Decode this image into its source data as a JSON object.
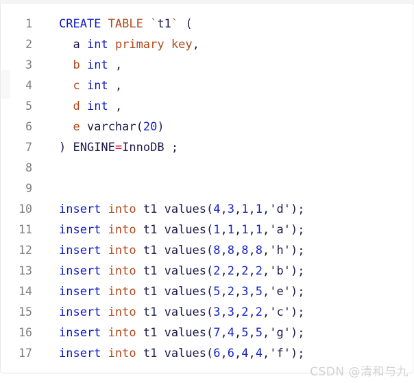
{
  "watermark": {
    "text": "CSDN @清和与九"
  },
  "colors": {
    "keyword_blue": "#0d19c8",
    "keyword_rust": "#b2481c",
    "identifier": "#1b1b4b",
    "number": "#1622c6",
    "equals": "#d81243",
    "line_number": "#7f7f7f",
    "background": "#ffffff",
    "border": "#e8e8e8",
    "watermark": "#d2d2d2"
  },
  "code_block": {
    "language": "sql",
    "lines": [
      {
        "number": "1",
        "text": "CREATE TABLE `t1` (",
        "tokens": [
          {
            "t": "CREATE",
            "c": "kw"
          },
          {
            "t": " ",
            "c": "op"
          },
          {
            "t": "TABLE",
            "c": "kw2"
          },
          {
            "t": " ",
            "c": "op"
          },
          {
            "t": "`",
            "c": "tick"
          },
          {
            "t": "t1",
            "c": "id"
          },
          {
            "t": "`",
            "c": "tick"
          },
          {
            "t": " (",
            "c": "op"
          }
        ]
      },
      {
        "number": "2",
        "text": "  a int primary key,",
        "tokens": [
          {
            "t": "  ",
            "c": "op"
          },
          {
            "t": "a",
            "c": "id"
          },
          {
            "t": " ",
            "c": "op"
          },
          {
            "t": "int",
            "c": "kw"
          },
          {
            "t": " ",
            "c": "op"
          },
          {
            "t": "primary",
            "c": "kw2"
          },
          {
            "t": " ",
            "c": "op"
          },
          {
            "t": "key",
            "c": "kw2"
          },
          {
            "t": ",",
            "c": "op"
          }
        ]
      },
      {
        "number": "3",
        "text": "  b int ,",
        "tokens": [
          {
            "t": "  ",
            "c": "op"
          },
          {
            "t": "b",
            "c": "col"
          },
          {
            "t": " ",
            "c": "op"
          },
          {
            "t": "int",
            "c": "kw"
          },
          {
            "t": " ",
            "c": "op"
          },
          {
            "t": ",",
            "c": "op"
          }
        ]
      },
      {
        "number": "4",
        "text": "  c int ,",
        "tokens": [
          {
            "t": "  ",
            "c": "op"
          },
          {
            "t": "c",
            "c": "col"
          },
          {
            "t": " ",
            "c": "op"
          },
          {
            "t": "int",
            "c": "kw"
          },
          {
            "t": " ",
            "c": "op"
          },
          {
            "t": ",",
            "c": "op"
          }
        ]
      },
      {
        "number": "5",
        "text": "  d int ,",
        "tokens": [
          {
            "t": "  ",
            "c": "op"
          },
          {
            "t": "d",
            "c": "col"
          },
          {
            "t": " ",
            "c": "op"
          },
          {
            "t": "int",
            "c": "kw"
          },
          {
            "t": " ",
            "c": "op"
          },
          {
            "t": ",",
            "c": "op"
          }
        ]
      },
      {
        "number": "6",
        "text": "  e varchar(20)",
        "tokens": [
          {
            "t": "  ",
            "c": "op"
          },
          {
            "t": "e",
            "c": "col"
          },
          {
            "t": " ",
            "c": "op"
          },
          {
            "t": "varchar",
            "c": "id"
          },
          {
            "t": "(",
            "c": "op"
          },
          {
            "t": "20",
            "c": "num"
          },
          {
            "t": ")",
            "c": "op"
          }
        ]
      },
      {
        "number": "7",
        "text": ") ENGINE=InnoDB ;",
        "tokens": [
          {
            "t": ") ",
            "c": "op"
          },
          {
            "t": "ENGINE",
            "c": "id"
          },
          {
            "t": "=",
            "c": "eq"
          },
          {
            "t": "InnoDB",
            "c": "id"
          },
          {
            "t": " ;",
            "c": "op"
          }
        ]
      },
      {
        "number": "8",
        "text": "",
        "tokens": []
      },
      {
        "number": "9",
        "text": "",
        "tokens": []
      },
      {
        "number": "10",
        "text": "insert into t1 values(4,3,1,1,'d');",
        "tokens": [
          {
            "t": "insert",
            "c": "kw"
          },
          {
            "t": " ",
            "c": "op"
          },
          {
            "t": "into",
            "c": "kw2"
          },
          {
            "t": " ",
            "c": "op"
          },
          {
            "t": "t1",
            "c": "id"
          },
          {
            "t": " ",
            "c": "op"
          },
          {
            "t": "values",
            "c": "id"
          },
          {
            "t": "(",
            "c": "op"
          },
          {
            "t": "4",
            "c": "num"
          },
          {
            "t": ",",
            "c": "op"
          },
          {
            "t": "3",
            "c": "num"
          },
          {
            "t": ",",
            "c": "op"
          },
          {
            "t": "1",
            "c": "num"
          },
          {
            "t": ",",
            "c": "op"
          },
          {
            "t": "1",
            "c": "num"
          },
          {
            "t": ",",
            "c": "op"
          },
          {
            "t": "'d'",
            "c": "str"
          },
          {
            "t": ");",
            "c": "op"
          }
        ]
      },
      {
        "number": "11",
        "text": "insert into t1 values(1,1,1,1,'a');",
        "tokens": [
          {
            "t": "insert",
            "c": "kw"
          },
          {
            "t": " ",
            "c": "op"
          },
          {
            "t": "into",
            "c": "kw2"
          },
          {
            "t": " ",
            "c": "op"
          },
          {
            "t": "t1",
            "c": "id"
          },
          {
            "t": " ",
            "c": "op"
          },
          {
            "t": "values",
            "c": "id"
          },
          {
            "t": "(",
            "c": "op"
          },
          {
            "t": "1",
            "c": "num"
          },
          {
            "t": ",",
            "c": "op"
          },
          {
            "t": "1",
            "c": "num"
          },
          {
            "t": ",",
            "c": "op"
          },
          {
            "t": "1",
            "c": "num"
          },
          {
            "t": ",",
            "c": "op"
          },
          {
            "t": "1",
            "c": "num"
          },
          {
            "t": ",",
            "c": "op"
          },
          {
            "t": "'a'",
            "c": "str"
          },
          {
            "t": ");",
            "c": "op"
          }
        ]
      },
      {
        "number": "12",
        "text": "insert into t1 values(8,8,8,8,'h');",
        "tokens": [
          {
            "t": "insert",
            "c": "kw"
          },
          {
            "t": " ",
            "c": "op"
          },
          {
            "t": "into",
            "c": "kw2"
          },
          {
            "t": " ",
            "c": "op"
          },
          {
            "t": "t1",
            "c": "id"
          },
          {
            "t": " ",
            "c": "op"
          },
          {
            "t": "values",
            "c": "id"
          },
          {
            "t": "(",
            "c": "op"
          },
          {
            "t": "8",
            "c": "num"
          },
          {
            "t": ",",
            "c": "op"
          },
          {
            "t": "8",
            "c": "num"
          },
          {
            "t": ",",
            "c": "op"
          },
          {
            "t": "8",
            "c": "num"
          },
          {
            "t": ",",
            "c": "op"
          },
          {
            "t": "8",
            "c": "num"
          },
          {
            "t": ",",
            "c": "op"
          },
          {
            "t": "'h'",
            "c": "str"
          },
          {
            "t": ");",
            "c": "op"
          }
        ]
      },
      {
        "number": "13",
        "text": "insert into t1 values(2,2,2,2,'b');",
        "tokens": [
          {
            "t": "insert",
            "c": "kw"
          },
          {
            "t": " ",
            "c": "op"
          },
          {
            "t": "into",
            "c": "kw2"
          },
          {
            "t": " ",
            "c": "op"
          },
          {
            "t": "t1",
            "c": "id"
          },
          {
            "t": " ",
            "c": "op"
          },
          {
            "t": "values",
            "c": "id"
          },
          {
            "t": "(",
            "c": "op"
          },
          {
            "t": "2",
            "c": "num"
          },
          {
            "t": ",",
            "c": "op"
          },
          {
            "t": "2",
            "c": "num"
          },
          {
            "t": ",",
            "c": "op"
          },
          {
            "t": "2",
            "c": "num"
          },
          {
            "t": ",",
            "c": "op"
          },
          {
            "t": "2",
            "c": "num"
          },
          {
            "t": ",",
            "c": "op"
          },
          {
            "t": "'b'",
            "c": "str"
          },
          {
            "t": ");",
            "c": "op"
          }
        ]
      },
      {
        "number": "14",
        "text": "insert into t1 values(5,2,3,5,'e');",
        "tokens": [
          {
            "t": "insert",
            "c": "kw"
          },
          {
            "t": " ",
            "c": "op"
          },
          {
            "t": "into",
            "c": "kw2"
          },
          {
            "t": " ",
            "c": "op"
          },
          {
            "t": "t1",
            "c": "id"
          },
          {
            "t": " ",
            "c": "op"
          },
          {
            "t": "values",
            "c": "id"
          },
          {
            "t": "(",
            "c": "op"
          },
          {
            "t": "5",
            "c": "num"
          },
          {
            "t": ",",
            "c": "op"
          },
          {
            "t": "2",
            "c": "num"
          },
          {
            "t": ",",
            "c": "op"
          },
          {
            "t": "3",
            "c": "num"
          },
          {
            "t": ",",
            "c": "op"
          },
          {
            "t": "5",
            "c": "num"
          },
          {
            "t": ",",
            "c": "op"
          },
          {
            "t": "'e'",
            "c": "str"
          },
          {
            "t": ");",
            "c": "op"
          }
        ]
      },
      {
        "number": "15",
        "text": "insert into t1 values(3,3,2,2,'c');",
        "tokens": [
          {
            "t": "insert",
            "c": "kw"
          },
          {
            "t": " ",
            "c": "op"
          },
          {
            "t": "into",
            "c": "kw2"
          },
          {
            "t": " ",
            "c": "op"
          },
          {
            "t": "t1",
            "c": "id"
          },
          {
            "t": " ",
            "c": "op"
          },
          {
            "t": "values",
            "c": "id"
          },
          {
            "t": "(",
            "c": "op"
          },
          {
            "t": "3",
            "c": "num"
          },
          {
            "t": ",",
            "c": "op"
          },
          {
            "t": "3",
            "c": "num"
          },
          {
            "t": ",",
            "c": "op"
          },
          {
            "t": "2",
            "c": "num"
          },
          {
            "t": ",",
            "c": "op"
          },
          {
            "t": "2",
            "c": "num"
          },
          {
            "t": ",",
            "c": "op"
          },
          {
            "t": "'c'",
            "c": "str"
          },
          {
            "t": ");",
            "c": "op"
          }
        ]
      },
      {
        "number": "16",
        "text": "insert into t1 values(7,4,5,5,'g');",
        "tokens": [
          {
            "t": "insert",
            "c": "kw"
          },
          {
            "t": " ",
            "c": "op"
          },
          {
            "t": "into",
            "c": "kw2"
          },
          {
            "t": " ",
            "c": "op"
          },
          {
            "t": "t1",
            "c": "id"
          },
          {
            "t": " ",
            "c": "op"
          },
          {
            "t": "values",
            "c": "id"
          },
          {
            "t": "(",
            "c": "op"
          },
          {
            "t": "7",
            "c": "num"
          },
          {
            "t": ",",
            "c": "op"
          },
          {
            "t": "4",
            "c": "num"
          },
          {
            "t": ",",
            "c": "op"
          },
          {
            "t": "5",
            "c": "num"
          },
          {
            "t": ",",
            "c": "op"
          },
          {
            "t": "5",
            "c": "num"
          },
          {
            "t": ",",
            "c": "op"
          },
          {
            "t": "'g'",
            "c": "str"
          },
          {
            "t": ");",
            "c": "op"
          }
        ]
      },
      {
        "number": "17",
        "text": "insert into t1 values(6,6,4,4,'f');",
        "tokens": [
          {
            "t": "insert",
            "c": "kw"
          },
          {
            "t": " ",
            "c": "op"
          },
          {
            "t": "into",
            "c": "kw2"
          },
          {
            "t": " ",
            "c": "op"
          },
          {
            "t": "t1",
            "c": "id"
          },
          {
            "t": " ",
            "c": "op"
          },
          {
            "t": "values",
            "c": "id"
          },
          {
            "t": "(",
            "c": "op"
          },
          {
            "t": "6",
            "c": "num"
          },
          {
            "t": ",",
            "c": "op"
          },
          {
            "t": "6",
            "c": "num"
          },
          {
            "t": ",",
            "c": "op"
          },
          {
            "t": "4",
            "c": "num"
          },
          {
            "t": ",",
            "c": "op"
          },
          {
            "t": "4",
            "c": "num"
          },
          {
            "t": ",",
            "c": "op"
          },
          {
            "t": "'f'",
            "c": "str"
          },
          {
            "t": ");",
            "c": "op"
          }
        ]
      }
    ]
  }
}
